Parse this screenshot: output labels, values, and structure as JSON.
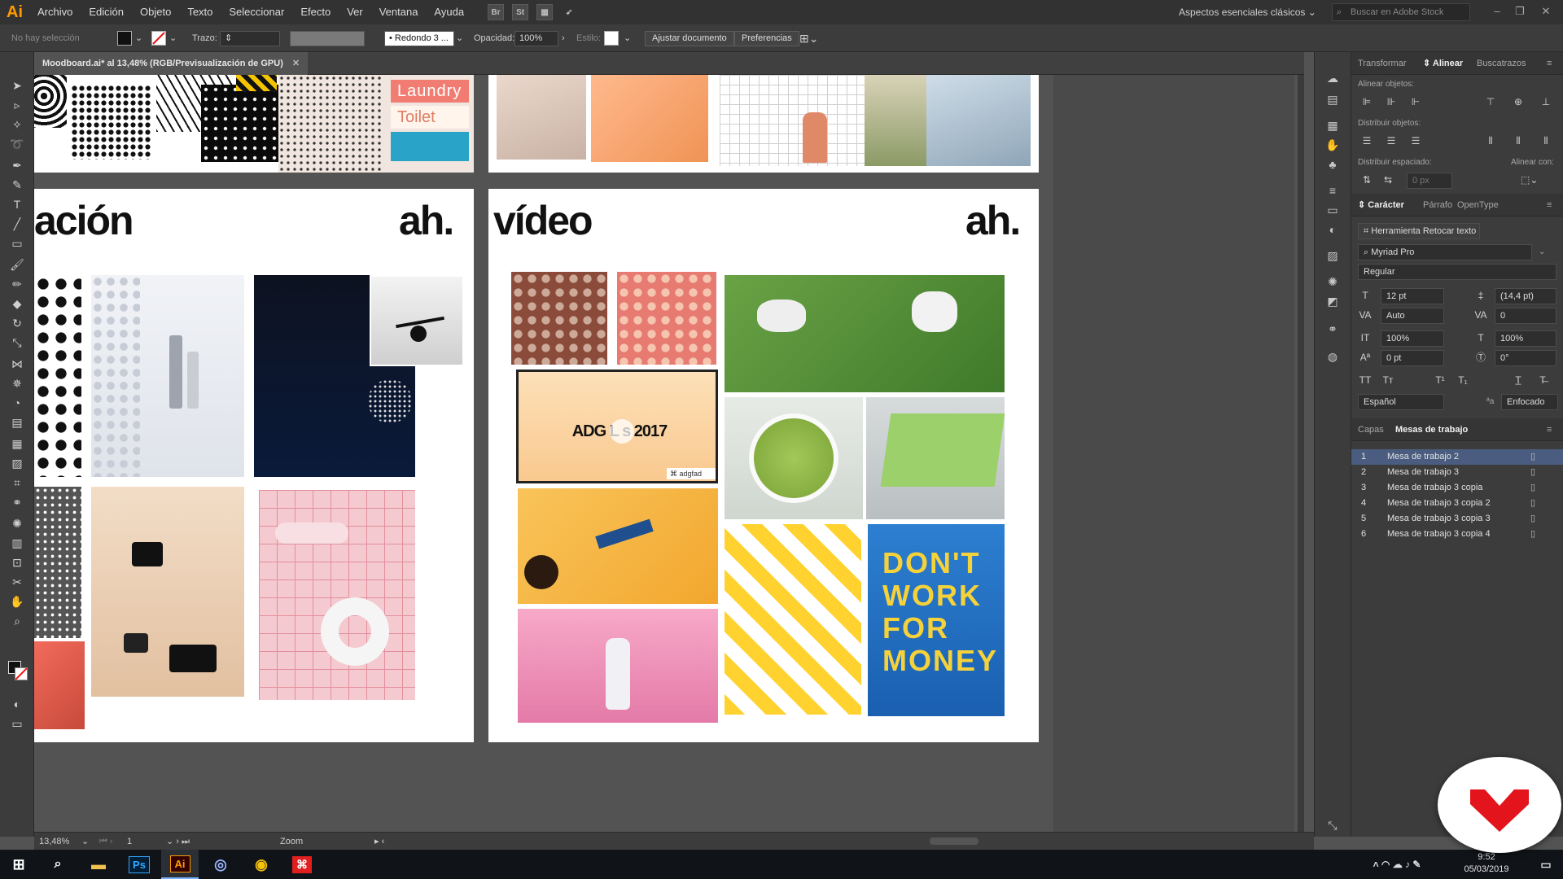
{
  "app": {
    "logo": "Ai",
    "brand_color": "#ff9a00"
  },
  "menu": [
    "Archivo",
    "Edición",
    "Objeto",
    "Texto",
    "Seleccionar",
    "Efecto",
    "Ver",
    "Ventana",
    "Ayuda"
  ],
  "menu_icons": [
    "Br",
    "St"
  ],
  "workspace": "Aspectos esenciales clásicos",
  "stock_search_placeholder": "Buscar en Adobe Stock",
  "control": {
    "selection": "No hay selección",
    "stroke_label": "Trazo:",
    "brush": "Redondo 3 ...",
    "opacity_label": "Opacidad:",
    "opacity": "100%",
    "style_label": "Estilo:",
    "fit_doc": "Ajustar documento",
    "prefs": "Preferencias"
  },
  "doc_tab": "Moodboard.ai* al 13,48% (RGB/Previsualización de GPU)",
  "canvas": {
    "artboard_left_title": "ación",
    "artboard_left_brand": "ah.",
    "artboard_right_title": "vídeo",
    "artboard_right_brand": "ah.",
    "laundry": "Laundry",
    "toilet": "Toilet",
    "adg": "ADG L s 2017",
    "adg_channel": "adgfad",
    "dont_work": [
      "DON'T",
      "WORK",
      "FOR",
      "MONEY"
    ]
  },
  "panels": {
    "align_tabs": [
      "Transformar",
      "Alinear",
      "Buscatrazos"
    ],
    "align_objects": "Alinear objetos:",
    "distribute_objects": "Distribuir objetos:",
    "distribute_spacing": "Distribuir espaciado:",
    "align_to": "Alinear con:",
    "spacing_value": "0 px",
    "char_tabs": [
      "Carácter",
      "Párrafo",
      "OpenType"
    ],
    "touch_type": "Herramienta Retocar texto",
    "font_family": "Myriad Pro",
    "font_style": "Regular",
    "font_size": "12 pt",
    "leading": "(14,4 pt)",
    "kerning": "Auto",
    "tracking": "0",
    "vscale": "100%",
    "hscale": "100%",
    "baseline": "0 pt",
    "rotation": "0°",
    "language": "Español",
    "antialias": "Enfocado",
    "layer_tabs": [
      "Capas",
      "Mesas de trabajo"
    ],
    "artboards": [
      {
        "num": "1",
        "name": "Mesa de trabajo 2"
      },
      {
        "num": "2",
        "name": "Mesa de trabajo 3"
      },
      {
        "num": "3",
        "name": "Mesa de trabajo 3 copia"
      },
      {
        "num": "4",
        "name": "Mesa de trabajo 3 copia 2"
      },
      {
        "num": "5",
        "name": "Mesa de trabajo 3 copia 3"
      },
      {
        "num": "6",
        "name": "Mesa de trabajo 3 copia 4"
      }
    ]
  },
  "status": {
    "zoom": "13,48%",
    "page": "1",
    "tool": "Zoom"
  },
  "taskbar": {
    "apps": [
      "Ps",
      "Ai"
    ],
    "time": "9:52",
    "date": "05/03/2019"
  }
}
